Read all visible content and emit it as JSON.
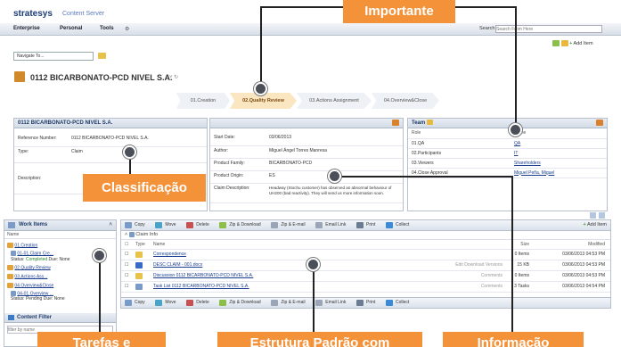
{
  "header": {
    "brand": "stratesys",
    "product": "Content Server",
    "menu": [
      "Enterprise",
      "Personal",
      "Tools"
    ],
    "search_label": "Search",
    "search_placeholder": "Search From Here",
    "add_item": "Add Item"
  },
  "navigate_placeholder": "Navigate To...",
  "folder_title": "0112 BICARBONATO-PCD NIVEL S.A.",
  "workflow": [
    "01.Creation",
    "02.Quality Review",
    "03.Actions Assignment",
    "04.Overview&Close"
  ],
  "workflow_active": 1,
  "classification": {
    "title": "0112 BICARBONATO-PCD NIVEL S.A.",
    "rows": [
      {
        "label": "Reference Number:",
        "value": "0112 BICARBONATO-PCD NIVEL S.A."
      },
      {
        "label": "Type:",
        "value": "Claim"
      },
      {
        "label": "Description:",
        "value": ""
      }
    ]
  },
  "details": {
    "rows": [
      {
        "label": "Start Date:",
        "value": "03/06/2013"
      },
      {
        "label": "Author:",
        "value": "Miguel Ángel Torres Manresa"
      },
      {
        "label": "Product Family:",
        "value": "BICARBONATO-PCD"
      },
      {
        "label": "Product Origin:",
        "value": "ES"
      },
      {
        "label": "Claim Description:",
        "value": "Headway (Stochu customer) has observed an abnormal behaviour of UH200 (bad reactivity). They will send us more information soon."
      }
    ]
  },
  "team": {
    "title": "Team",
    "columns": [
      "Role",
      "Name"
    ],
    "rows": [
      [
        "01.QA",
        "QA"
      ],
      [
        "02.Participants",
        "IT"
      ],
      [
        "03.Viewers",
        "Shareholders"
      ],
      [
        "04.Close Approval",
        "Miguel Peña, Miguel"
      ]
    ]
  },
  "work_items": {
    "title": "Work Items",
    "column": "Name",
    "items": [
      {
        "name": "01.Creation"
      },
      {
        "name": "01-01.Claim Cre...",
        "status_label": "Status:",
        "status": "Completed",
        "due": "Due: None"
      },
      {
        "name": "02.Quality Review"
      },
      {
        "name": "03.Actions Ass..."
      },
      {
        "name": "04.Overview&Close"
      },
      {
        "name": "04-01.Overview ...",
        "status_label": "Status:",
        "status": "Pending",
        "due": "Due: None"
      }
    ]
  },
  "content_filter": {
    "title": "Content Filter",
    "placeholder": "filter by name"
  },
  "toolbar": [
    "Copy",
    "Move",
    "Delete",
    "Zip & Download",
    "Zip & E-mail",
    "Email Link",
    "Print",
    "Collect"
  ],
  "claim_info": {
    "title": "Claim Info",
    "columns": [
      "Type",
      "Name",
      "Size",
      "Modified"
    ],
    "rows": [
      {
        "name": "Correspondence",
        "note": "",
        "size": "0 Items",
        "modified": "03/06/2013 04:53 PM"
      },
      {
        "name": "DESC CLAIM - 001.docx",
        "note": "Edit  Download  Versions",
        "size": "15 KB",
        "modified": "03/06/2013 04:53 PM"
      },
      {
        "name": "Discussion 0112 BICARBONATO-PCD NIVEL S.A.",
        "note": "Comments",
        "size": "0 Items",
        "modified": "03/06/2013 04:53 PM"
      },
      {
        "name": "Task List 0112 BICARBONATO-PCD NIVEL S.A.",
        "note": "Comments",
        "size": "3 Tasks",
        "modified": "03/06/2013 04:54 PM"
      }
    ]
  },
  "callouts": {
    "top": "Importante",
    "left": "Classificação",
    "bottom": [
      "Tarefas e",
      "Estrutura Padrão com",
      "Informação"
    ]
  }
}
